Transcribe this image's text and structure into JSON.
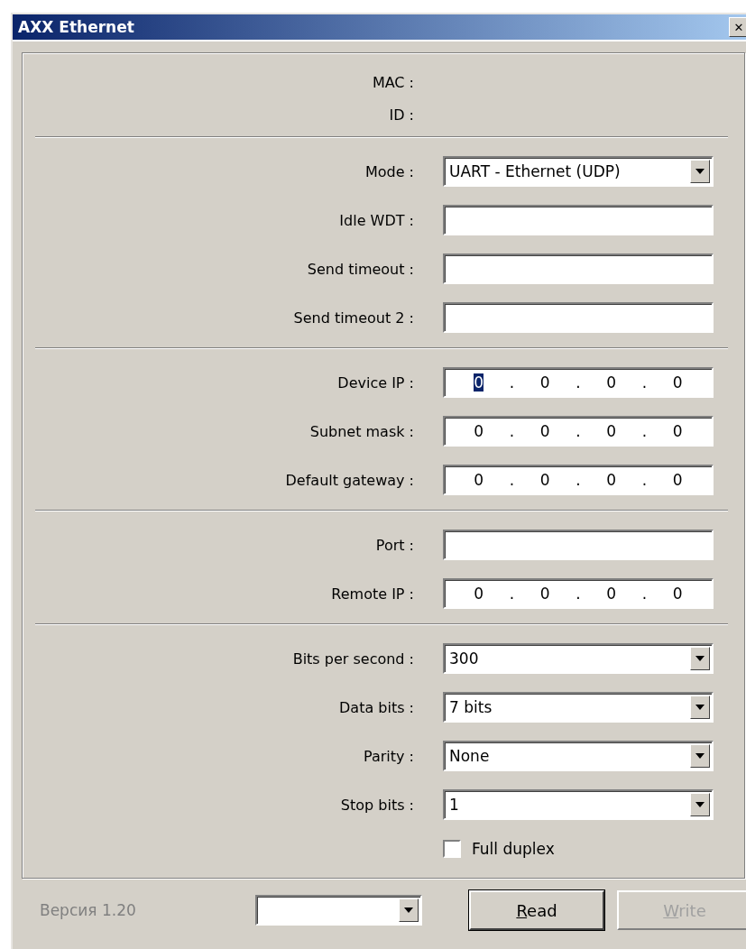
{
  "window": {
    "title": "AXX Ethernet",
    "close": "✕"
  },
  "sections": [
    {
      "rows": [
        {
          "label": "MAC :",
          "kind": "info"
        },
        {
          "label": "ID :",
          "kind": "info"
        }
      ]
    },
    {
      "rows": [
        {
          "label": "Mode :",
          "kind": "select",
          "value": "UART - Ethernet (UDP)"
        },
        {
          "label": "Idle WDT :",
          "kind": "text"
        },
        {
          "label": "Send timeout :",
          "kind": "text"
        },
        {
          "label": "Send timeout 2 :",
          "kind": "text"
        }
      ]
    },
    {
      "rows": [
        {
          "label": "Device IP :",
          "kind": "ip",
          "octets": [
            {
              "text": "0",
              "selected": true
            },
            {
              "text": "0",
              "selected": false
            },
            {
              "text": "0",
              "selected": false
            },
            {
              "text": "0",
              "selected": false
            }
          ],
          "separators": [
            ".",
            ".",
            "."
          ]
        },
        {
          "label": "Subnet mask :",
          "kind": "ip",
          "octets": [
            {
              "text": "0",
              "selected": false
            },
            {
              "text": "0",
              "selected": false
            },
            {
              "text": "0",
              "selected": false
            },
            {
              "text": "0",
              "selected": false
            }
          ],
          "separators": [
            ".",
            ".",
            "."
          ]
        },
        {
          "label": "Default gateway :",
          "kind": "ip",
          "octets": [
            {
              "text": "0",
              "selected": false
            },
            {
              "text": "0",
              "selected": false
            },
            {
              "text": "0",
              "selected": false
            },
            {
              "text": "0",
              "selected": false
            }
          ],
          "separators": [
            ".",
            ".",
            "."
          ]
        }
      ]
    },
    {
      "rows": [
        {
          "label": "Port :",
          "kind": "text"
        },
        {
          "label": "Remote IP :",
          "kind": "ip",
          "octets": [
            {
              "text": "0",
              "selected": false
            },
            {
              "text": "0",
              "selected": false
            },
            {
              "text": "0",
              "selected": false
            },
            {
              "text": "0",
              "selected": false
            }
          ],
          "separators": [
            ".",
            ".",
            "."
          ]
        }
      ]
    },
    {
      "rows": [
        {
          "label": "Bits per second :",
          "kind": "select",
          "value": "300"
        },
        {
          "label": "Data bits :",
          "kind": "select",
          "value": "7 bits"
        },
        {
          "label": "Parity :",
          "kind": "select",
          "value": "None"
        },
        {
          "label": "Stop bits :",
          "kind": "select",
          "value": "1"
        },
        {
          "label": "Full duplex",
          "kind": "checkbox",
          "checked": false
        }
      ]
    }
  ],
  "footer": {
    "version": {
      "text": "Версия 1.20",
      "disabled": true
    },
    "buttons": [
      {
        "label": "Read",
        "disabled": false,
        "mnemonic": true
      },
      {
        "label": "Write",
        "disabled": true,
        "mnemonic": true
      }
    ]
  }
}
